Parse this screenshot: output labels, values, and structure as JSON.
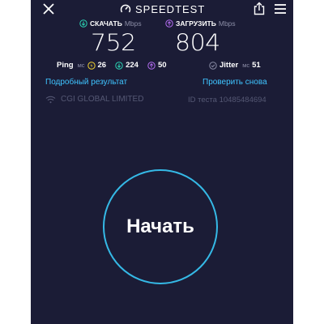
{
  "header": {
    "logo_text": "SPEEDTEST",
    "icons": {
      "close": "close-icon",
      "logo": "speedometer-icon",
      "share": "share-icon",
      "menu": "menu-icon"
    }
  },
  "results": {
    "download": {
      "label": "СКАЧАТЬ",
      "unit": "Mbps",
      "value": "752",
      "icon": "download-arrow-icon",
      "color": "#2bd4b4"
    },
    "upload": {
      "label": "ЗАГРУЗИТЬ",
      "unit": "Mbps",
      "value": "804",
      "icon": "upload-arrow-icon",
      "color": "#b26cf0"
    }
  },
  "latency": {
    "ping_label": "Ping",
    "unit": "мс",
    "idle": {
      "value": "26",
      "icon": "idle-latency-icon",
      "color": "#f2d230"
    },
    "download": {
      "value": "224",
      "icon": "download-latency-icon",
      "color": "#2bd4b4"
    },
    "upload": {
      "value": "50",
      "icon": "upload-latency-icon",
      "color": "#b26cf0"
    },
    "jitter_label": "Jitter",
    "jitter_value": "51"
  },
  "links": {
    "detailed": "Подробный результат",
    "retry": "Проверить снова"
  },
  "provider": {
    "name": "CGI GLOBAL LIMITED",
    "test_id": "ID теста 10485484694",
    "icon": "wifi-icon"
  },
  "start_button": {
    "label": "Начать",
    "color": "#35b9e6"
  },
  "colors": {
    "background": "#1b1c36",
    "accent": "#3fc4ff"
  }
}
